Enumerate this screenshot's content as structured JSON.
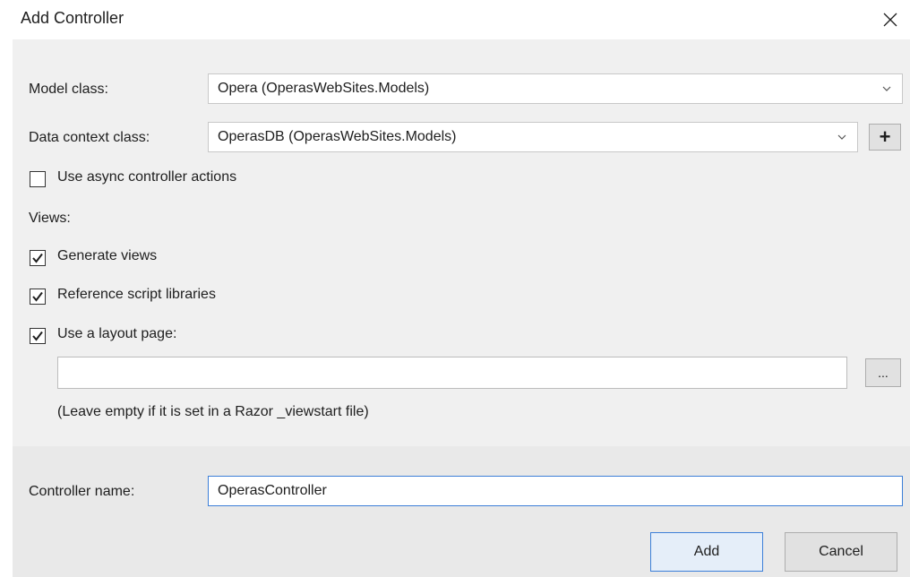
{
  "dialog": {
    "title": "Add Controller"
  },
  "form": {
    "model_class_label": "Model class:",
    "model_class_value": "Opera (OperasWebSites.Models)",
    "data_context_label": "Data context class:",
    "data_context_value": "OperasDB (OperasWebSites.Models)",
    "add_context_button": "+",
    "async_label": "Use async controller actions",
    "async_checked": false,
    "views_label": "Views:",
    "generate_views_label": "Generate views",
    "generate_views_checked": true,
    "reference_scripts_label": "Reference script libraries",
    "reference_scripts_checked": true,
    "layout_page_label": "Use a layout page:",
    "layout_page_checked": true,
    "layout_page_value": "",
    "browse_button": "...",
    "layout_hint": "(Leave empty if it is set in a Razor _viewstart file)"
  },
  "footer": {
    "controller_name_label": "Controller name:",
    "controller_name_value": "OperasController",
    "add_button": "Add",
    "cancel_button": "Cancel"
  },
  "icons": {
    "close": "close-icon",
    "chevron": "chevron-down-icon",
    "check": "check-icon"
  },
  "colors": {
    "content_bg": "#f0f0f0",
    "footer_bg": "#e9e9e9",
    "focus_blue": "#3c7fd8"
  }
}
